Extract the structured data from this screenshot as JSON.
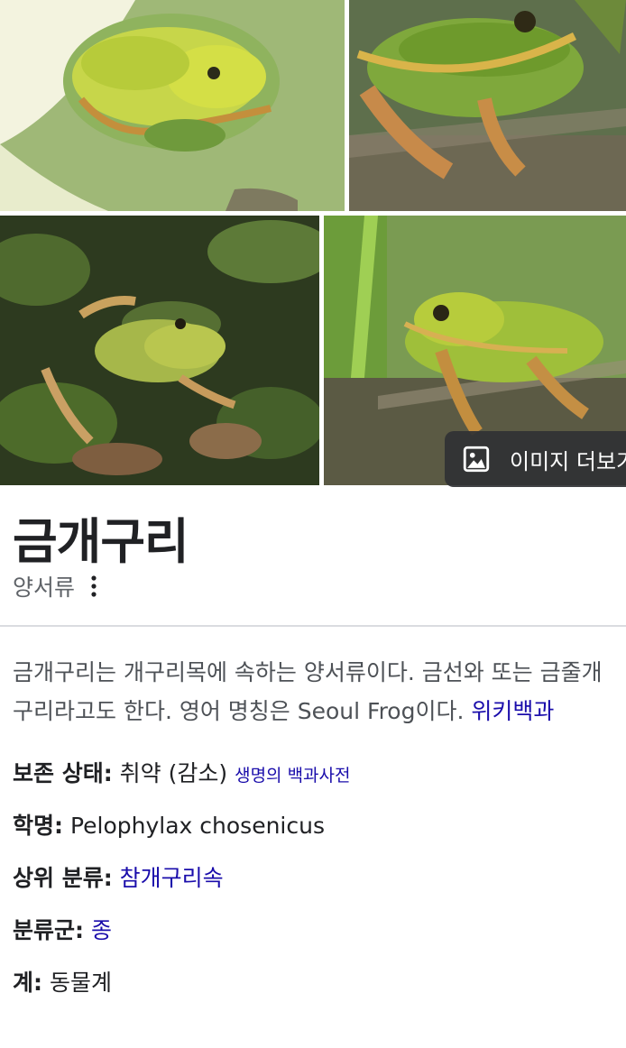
{
  "gallery": {
    "images": [
      "frog-on-lotus-leaf",
      "frog-on-ground",
      "frog-among-plants",
      "frog-in-grass"
    ],
    "more_images_label": "이미지 더보기",
    "more_images_icon": "image-icon"
  },
  "entity": {
    "title": "금개구리",
    "subtitle": "양서류",
    "menu_icon": "more-vert-icon"
  },
  "description": {
    "text": "금개구리는 개구리목에 속하는 양서류이다. 금선와 또는 금줄개구리라고도 한다. 영어 명칭은 Seoul Frog이다. ",
    "source_link": "위키백과"
  },
  "facts": [
    {
      "label": "보존 상태",
      "value": "취약 (감소)",
      "link": "생명의 백과사전"
    },
    {
      "label": "학명",
      "value": "Pelophylax chosenicus"
    },
    {
      "label": "상위 분류",
      "link": "참개구리속"
    },
    {
      "label": "분류군",
      "link": "종"
    },
    {
      "label": "계",
      "value": "동물계"
    }
  ],
  "colors": {
    "link": "#1a0dab",
    "title": "#202124",
    "subtitle": "#5f6368",
    "body": "#4d5156",
    "divider": "#dadce0",
    "overlay": "#303134"
  }
}
